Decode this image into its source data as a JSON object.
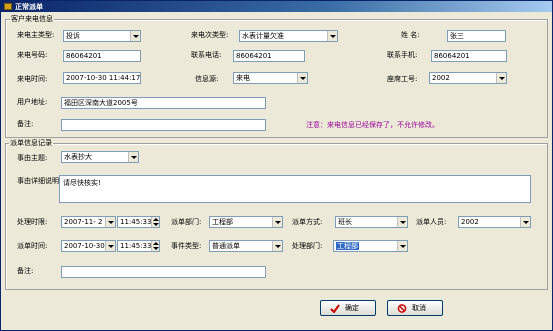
{
  "window": {
    "title": "正常派单"
  },
  "customer_group": {
    "legend": "客户来电信息",
    "main_type_label": "来电主类型:",
    "main_type_value": "投诉",
    "sub_type_label": "来电次类型:",
    "sub_type_value": "水表计量欠准",
    "name_label": "姓    名:",
    "name_value": "张三",
    "phone_label": "来电号码:",
    "phone_value": "86064201",
    "contact_phone_label": "联系电话:",
    "contact_phone_value": "86064201",
    "mobile_label": "联系手机:",
    "mobile_value": "86064201",
    "time_label": "来电时间:",
    "time_value": "2007-10-30 11:44:17",
    "source_label": "信息源:",
    "source_value": "来电",
    "seat_label": "座席工号:",
    "seat_value": "2002",
    "address_label": "用户地址:",
    "address_value": "福田区深南大道2005号",
    "remark_label": "备注:",
    "remark_value": "",
    "notice": "注意：来电信息已经保存了，不允许修改。"
  },
  "dispatch_group": {
    "legend": "派单信息记录",
    "subject_label": "事由主题:",
    "subject_value": "水表抄大",
    "detail_label": "事由详细说明:",
    "detail_value": "请尽快核实!",
    "deadline_label": "处理时限:",
    "deadline_date": "2007-11- 2",
    "deadline_time": "11:45:33",
    "dept_label": "派单部门:",
    "dept_value": "工程部",
    "method_label": "派单方式:",
    "method_value": "班长",
    "person_label": "派单人员:",
    "person_value": "2002",
    "dispatch_time_label": "派单时间:",
    "dispatch_date": "2007-10-30",
    "dispatch_time": "11:45:33",
    "event_type_label": "事件类型:",
    "event_type_value": "普通派单",
    "handle_dept_label": "处理部门:",
    "handle_dept_value": "工程部",
    "remark_label": "备注:",
    "remark_value": ""
  },
  "buttons": {
    "ok_label": "确定",
    "cancel_label": "取消"
  },
  "colors": {
    "title_bar": "#0a246a",
    "notice": "#990099",
    "ok_icon": "#cc0000",
    "cancel_icon": "#cc0000"
  },
  "icons": {
    "ok": "checkmark-icon",
    "cancel": "no-entry-icon"
  }
}
